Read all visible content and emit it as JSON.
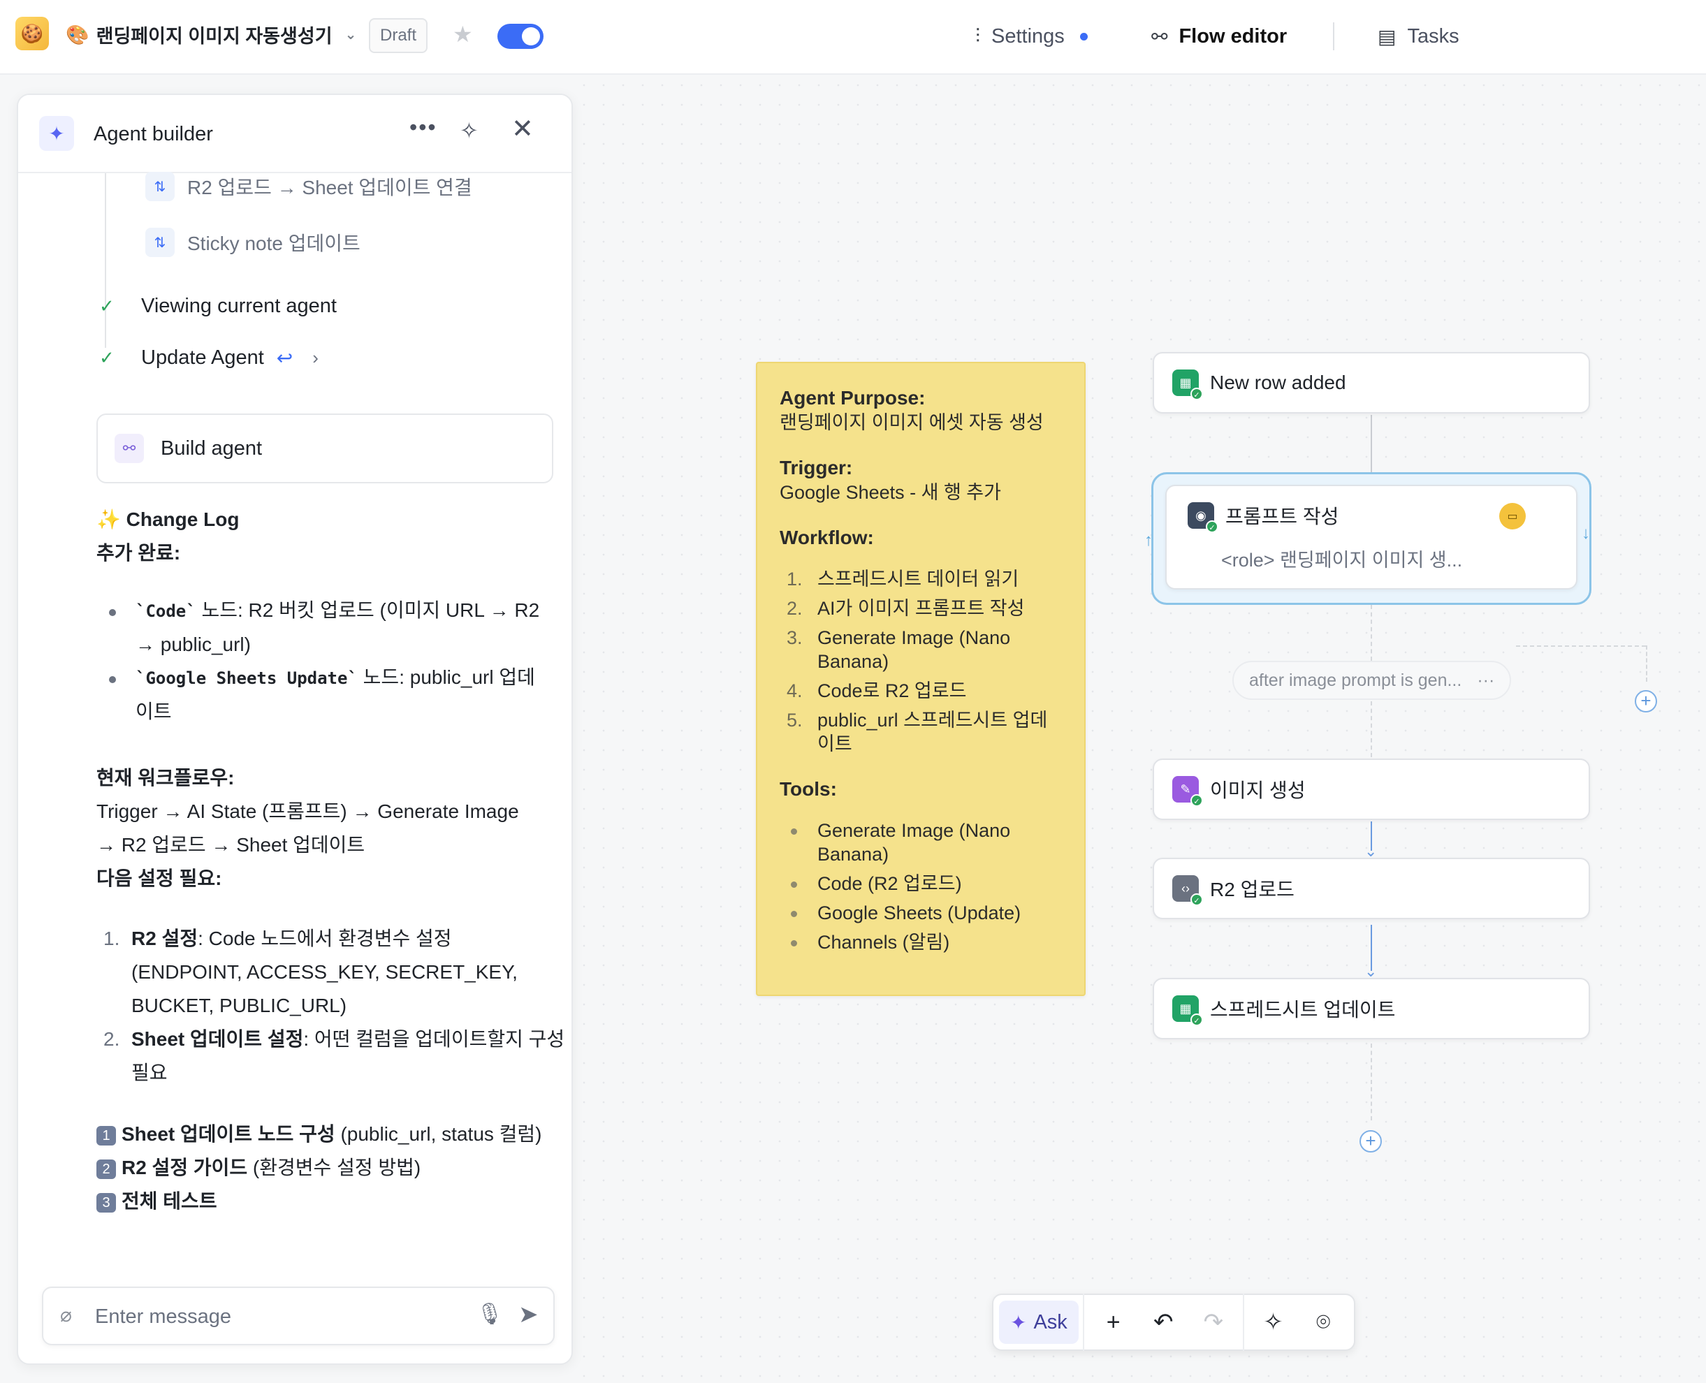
{
  "topbar": {
    "agent_emoji": "🎨",
    "agent_name": "랜딩페이지 이미지 자동생성기",
    "status_badge": "Draft",
    "nav": {
      "settings": "Settings",
      "flow_editor": "Flow editor",
      "tasks": "Tasks"
    }
  },
  "builder": {
    "title": "Agent builder",
    "steps": [
      {
        "label": "R2 업로드 → Sheet 업데이트 연결"
      },
      {
        "label": "Sticky note 업데이트"
      }
    ],
    "checks": [
      {
        "label": "Viewing current agent"
      },
      {
        "label": "Update Agent"
      }
    ],
    "build_card": "Build agent",
    "change_log": {
      "title": "Change Log",
      "added_heading": "추가 완료:",
      "added": [
        {
          "code": "`Code`",
          "text": " 노드: R2 버킷 업로드 (이미지 URL → R2",
          "text2": "→ public_url)"
        },
        {
          "code": "`Google Sheets Update`",
          "text": " 노드: public_url 업데",
          "text2": "이트"
        }
      ],
      "workflow_heading": "현재 워크플로우:",
      "workflow_line1": "Trigger → AI State (프롬프트) → Generate Image",
      "workflow_line2": "→ R2 업로드 → Sheet 업데이트",
      "needs_heading": "다음 설정 필요:",
      "needs": [
        {
          "num": "1.",
          "bold": "R2 설정",
          "line1": ": Code 노드에서 환경변수 설정",
          "line2": "(ENDPOINT, ACCESS_KEY, SECRET_KEY,",
          "line3": "BUCKET, PUBLIC_URL)"
        },
        {
          "num": "2.",
          "bold": "Sheet 업데이트 설정",
          "line1": ": 어떤 컬럼을 업데이트할지 구성",
          "line2": "필요"
        }
      ],
      "next": [
        {
          "badge": "1",
          "bold": "Sheet 업데이트 노드 구성",
          "rest": " (public_url, status 컬럼)"
        },
        {
          "badge": "2",
          "bold": "R2 설정 가이드",
          "rest": " (환경변수 설정 방법)"
        },
        {
          "badge": "3",
          "bold": "전체 테스트",
          "rest": ""
        }
      ]
    },
    "input_placeholder": "Enter message"
  },
  "sticky": {
    "purpose_label": "Agent Purpose:",
    "purpose": "랜딩페이지 이미지 에셋 자동 생성",
    "trigger_label": "Trigger:",
    "trigger": "Google Sheets - 새 행 추가",
    "workflow_label": "Workflow:",
    "workflow": [
      {
        "n": "1.",
        "a": "스프레드시트 데이터 읽기",
        "b": ""
      },
      {
        "n": "2.",
        "a": "AI가 이미지 프롬프트 작성",
        "b": ""
      },
      {
        "n": "3.",
        "a": "Generate Image (Nano",
        "b": "Banana)"
      },
      {
        "n": "4.",
        "a": "Code로 R2 업로드",
        "b": ""
      },
      {
        "n": "5.",
        "a": "public_url 스프레드시트 업데",
        "b": "이트"
      }
    ],
    "tools_label": "Tools:",
    "tools": [
      {
        "a": "Generate Image (Nano",
        "b": "Banana)"
      },
      {
        "a": "Code (R2 업로드)",
        "b": ""
      },
      {
        "a": "Google Sheets (Update)",
        "b": ""
      },
      {
        "a": "Channels (알림)",
        "b": ""
      }
    ]
  },
  "flow": {
    "trigger_node": "New row added",
    "prompt_node": {
      "title": "프롬프트 작성",
      "subtitle": "<role> 랜딩페이지 이미지 생..."
    },
    "edge_label": "after image prompt is gen...",
    "image_node": "이미지 생성",
    "r2_node": "R2 업로드",
    "sheet_node": "스프레드시트 업데이트"
  },
  "toolbar": {
    "ask": "Ask"
  }
}
